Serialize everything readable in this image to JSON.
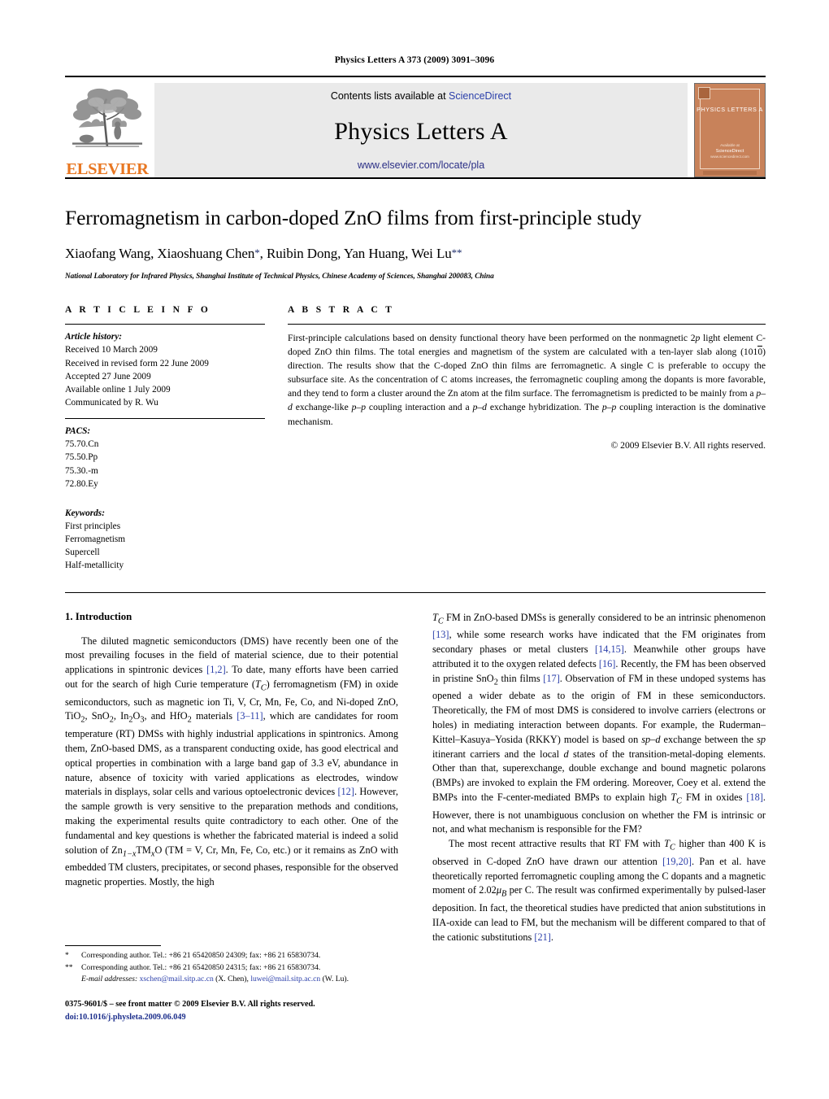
{
  "running_head": "Physics Letters A 373 (2009) 3091–3096",
  "masthead": {
    "publisher_name": "ELSEVIER",
    "contents_prefix": "Contents lists available at",
    "sciencedirect_link": "ScienceDirect",
    "journal_title": "Physics Letters A",
    "journal_url": "www.elsevier.com/locate/pla",
    "cover": {
      "title": "PHYSICS LETTERS A",
      "line1": "Available at",
      "line2": "ScienceDirect",
      "line3": "www.sciencedirect.com"
    },
    "colors": {
      "elsevier_orange": "#e87722",
      "link_blue": "#2b3faa",
      "banner_gray": "#eaeaea",
      "cover_orange": "#c8825a"
    }
  },
  "article": {
    "title": "Ferromagnetism in carbon-doped ZnO films from first-principle study",
    "authors": "Xiaofang Wang, Xiaoshuang Chen",
    "authors_part2": ", Ruibin Dong, Yan Huang, Wei Lu",
    "affiliation": "National Laboratory for Infrared Physics, Shanghai Institute of Technical Physics, Chinese Academy of Sciences, Shanghai 200083, China"
  },
  "article_info": {
    "heading": "A R T I C L E    I N F O",
    "history_label": "Article history:",
    "history": [
      "Received 10 March 2009",
      "Received in revised form 22 June 2009",
      "Accepted 27 June 2009",
      "Available online 1 July 2009",
      "Communicated by R. Wu"
    ],
    "pacs_label": "PACS:",
    "pacs": [
      "75.70.Cn",
      "75.50.Pp",
      "75.30.-m",
      "72.80.Ey"
    ],
    "keywords_label": "Keywords:",
    "keywords": [
      "First principles",
      "Ferromagnetism",
      "Supercell",
      "Half-metallicity"
    ]
  },
  "abstract": {
    "heading": "A B S T R A C T",
    "p1_a": "First-principle calculations based on density functional theory have been performed on the nonmagnetic 2",
    "p1_b": "p",
    "p1_c": " light element C-doped ZnO thin films. The total energies and magnetism of the system are calculated with a ten-layer slab along (101",
    "p1_overbar": "0",
    "p1_d": ") direction. The results show that the C-doped ZnO thin films are ferromagnetic. A single C is preferable to occupy the subsurface site. As the concentration of C atoms increases, the ferromagnetic coupling among the dopants is more favorable, and they tend to form a cluster around the Zn atom at the film surface. The ferromagnetism is predicted to be mainly from a ",
    "pd1": "p–d",
    "p1_e": " exchange-like ",
    "pp1": "p–p",
    "p1_f": " coupling interaction and a ",
    "pd2": "p–d",
    "p1_g": " exchange hybridization. The ",
    "pp2": "p–p",
    "p1_h": " coupling interaction is the dominative mechanism.",
    "copyright": "© 2009 Elsevier B.V. All rights reserved."
  },
  "body": {
    "section_heading": "1. Introduction",
    "left": {
      "para1_1": "The diluted magnetic semiconductors (DMS) have recently been one of the most prevailing focuses in the field of material science, due to their potential applications in spintronic devices ",
      "cite_12": "[1,2]",
      "para1_2": ". To date, many efforts have been carried out for the search of high Curie temperature (",
      "tc": "T",
      "tc_sub": "C",
      "para1_3": ") ferromagnetism (FM) in oxide semiconductors, such as magnetic ion Ti, V, Cr, Mn, Fe, Co, and Ni-doped ZnO, TiO",
      "sub2_a": "2",
      "para1_4": ", SnO",
      "sub2_b": "2",
      "para1_5": ", In",
      "sub2_c": "2",
      "para1_6": "O",
      "sub3_a": "3",
      "para1_7": ", and HfO",
      "sub2_d": "2",
      "para1_8": " materials ",
      "cite_311": "[3–11]",
      "para1_9": ", which are candidates for room temperature (RT) DMSs with highly industrial applications in spintronics. Among them, ZnO-based DMS, as a transparent conducting oxide, has good electrical and optical properties in combination with a large band gap of 3.3 eV, abundance in nature, absence of toxicity with varied applications as electrodes, window materials in displays, solar cells and various optoelectronic devices ",
      "cite_12b": "[12]",
      "para1_10": ". However, the sample growth is very sensitive to the preparation methods and conditions, making the experimental results quite contradictory to each other. One of the fundamental and key questions is whether the fabricated material is indeed a solid solution of Zn",
      "zn_sub1": "1−x",
      "para1_11": "TM",
      "zn_sub2": "x",
      "para1_12": "O (TM = V, Cr, Mn, Fe, Co, etc.) or it remains as ZnO with embedded TM clusters, precipitates, or second phases, responsible for the observed magnetic properties. Mostly, the high"
    },
    "right": {
      "para2_1a": "T",
      "para2_1a_sub": "C",
      "para2_1": " FM in ZnO-based DMSs is generally considered to be an intrinsic phenomenon ",
      "cite_13": "[13]",
      "para2_2": ", while some research works have indicated that the FM originates from secondary phases or metal clusters ",
      "cite_1415": "[14,15]",
      "para2_3": ". Meanwhile other groups have attributed it to the oxygen related defects ",
      "cite_16": "[16]",
      "para2_4": ". Recently, the FM has been observed in pristine SnO",
      "sub2_e": "2",
      "para2_5": " thin films ",
      "cite_17": "[17]",
      "para2_6": ". Observation of FM in these undoped systems has opened a wider debate as to the origin of FM in these semiconductors. Theoretically, the FM of most DMS is considered to involve carriers (electrons or holes) in mediating interaction between dopants. For example, the Ruderman–Kittel–Kasuya–Yosida (RKKY) model is based on ",
      "spd": "sp–d",
      "para2_7": " exchange between the ",
      "sp": "sp",
      "para2_8": " itinerant carriers and the local ",
      "d": "d",
      "para2_9": " states of the transition-metal-doping elements. Other than that, superexchange, double exchange and bound magnetic polarons (BMPs) are invoked to explain the FM ordering. Moreover, Coey et al. extend the BMPs into the F-center-mediated BMPs to explain high ",
      "tc2": "T",
      "tc2_sub": "C",
      "para2_10": " FM in oxides ",
      "cite_18": "[18]",
      "para2_11": ". However, there is not unambiguous conclusion on whether the FM is intrinsic or not, and what mechanism is responsible for the FM?",
      "para3_1": "The most recent attractive results that RT FM with ",
      "tc3": "T",
      "tc3_sub": "C",
      "para3_2": " higher than 400 K is observed in C-doped ZnO have drawn our attention ",
      "cite_1920": "[19,20]",
      "para3_3": ". Pan et al. have theoretically reported ferromagnetic coupling among the C dopants and a magnetic moment of 2.02",
      "mu": "μ",
      "mu_sub": "B",
      "para3_4": " per C. The result was confirmed experimentally by pulsed-laser deposition. In fact, the theoretical studies have predicted that anion substitutions in IIA-oxide can lead to FM, but the mechanism will be different compared to that of the cationic substitutions ",
      "cite_21": "[21]",
      "para3_5": "."
    }
  },
  "footnotes": {
    "mark1": "*",
    "note1": "Corresponding author. Tel.: +86 21 65420850 24309; fax: +86 21 65830734.",
    "mark2": "**",
    "note2": "Corresponding author. Tel.: +86 21 65420850 24315; fax: +86 21 65830734.",
    "email_label": "E-mail addresses:",
    "email1": "xschen@mail.sitp.ac.cn",
    "email1_name": "(X. Chen),",
    "email2": "luwei@mail.sitp.ac.cn",
    "email2_name": "(W. Lu).",
    "frontmatter": "0375-9601/$ – see front matter  © 2009 Elsevier B.V. All rights reserved.",
    "doi": "doi:10.1016/j.physleta.2009.06.049"
  }
}
